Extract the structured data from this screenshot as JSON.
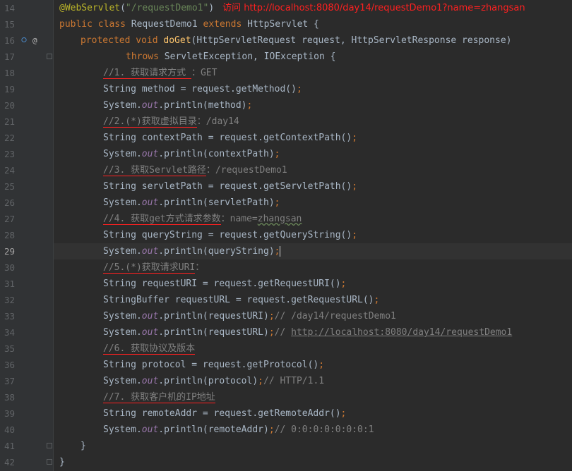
{
  "editor": {
    "current_line": 29,
    "annotation_note": "访问 http://localhost:8080/day14/requestDemo1?name=zhangsan",
    "lines": [
      {
        "n": 14,
        "indent": 0,
        "parts": [
          [
            "ann",
            "@WebServlet"
          ],
          [
            "",
            "("
          ],
          [
            "str",
            "\"/requestDemo1\""
          ],
          [
            "",
            ")"
          ]
        ],
        "note": true
      },
      {
        "n": 15,
        "indent": 0,
        "parts": [
          [
            "kw",
            "public class "
          ],
          [
            "",
            "RequestDemo1 "
          ],
          [
            "kw",
            "extends "
          ],
          [
            "",
            "HttpServlet {"
          ]
        ]
      },
      {
        "n": 16,
        "indent": 1,
        "parts": [
          [
            "kw",
            "protected void "
          ],
          [
            "fn",
            "doGet"
          ],
          [
            "",
            "(HttpServletRequest request, HttpServletResponse response)"
          ]
        ]
      },
      {
        "n": 17,
        "indent": 3,
        "parts": [
          [
            "kw",
            "throws "
          ],
          [
            "",
            "ServletException, IOException {"
          ]
        ]
      },
      {
        "n": 18,
        "indent": 2,
        "parts": [
          [
            "cm ul",
            "//1. 获取请求方式 "
          ],
          [
            "cm",
            "：GET"
          ]
        ]
      },
      {
        "n": 19,
        "indent": 2,
        "parts": [
          [
            "",
            "String method = request.getMethod()"
          ],
          [
            "kw",
            ";"
          ]
        ]
      },
      {
        "n": 20,
        "indent": 2,
        "parts": [
          [
            "",
            "System."
          ],
          [
            "fld",
            "out"
          ],
          [
            "",
            ".println(method)"
          ],
          [
            "kw",
            ";"
          ]
        ]
      },
      {
        "n": 21,
        "indent": 2,
        "parts": [
          [
            "cm ul",
            "//2.(*)获取虚拟目录"
          ],
          [
            "cm",
            "：/day14"
          ]
        ]
      },
      {
        "n": 22,
        "indent": 2,
        "parts": [
          [
            "",
            "String contextPath = request.getContextPath()"
          ],
          [
            "kw",
            ";"
          ]
        ]
      },
      {
        "n": 23,
        "indent": 2,
        "parts": [
          [
            "",
            "System."
          ],
          [
            "fld",
            "out"
          ],
          [
            "",
            ".println(contextPath)"
          ],
          [
            "kw",
            ";"
          ]
        ]
      },
      {
        "n": 24,
        "indent": 2,
        "parts": [
          [
            "cm ul",
            "//3. 获取Servlet路径"
          ],
          [
            "cm",
            "：/requestDemo1"
          ]
        ]
      },
      {
        "n": 25,
        "indent": 2,
        "parts": [
          [
            "",
            "String servletPath = request.getServletPath()"
          ],
          [
            "kw",
            ";"
          ]
        ]
      },
      {
        "n": 26,
        "indent": 2,
        "parts": [
          [
            "",
            "System."
          ],
          [
            "fld",
            "out"
          ],
          [
            "",
            ".println(servletPath)"
          ],
          [
            "kw",
            ";"
          ]
        ]
      },
      {
        "n": 27,
        "indent": 2,
        "parts": [
          [
            "cm ul",
            "//4. 获取get方式请求参数"
          ],
          [
            "cm",
            "：name="
          ],
          [
            "cm wavy",
            "zhangsan"
          ]
        ]
      },
      {
        "n": 28,
        "indent": 2,
        "parts": [
          [
            "",
            "String queryString = request.getQueryString()"
          ],
          [
            "kw",
            ";"
          ]
        ]
      },
      {
        "n": 29,
        "indent": 2,
        "parts": [
          [
            "",
            "System."
          ],
          [
            "fld",
            "out"
          ],
          [
            "",
            ".println(queryString)"
          ],
          [
            "kw",
            ";"
          ],
          [
            "caret",
            ""
          ]
        ]
      },
      {
        "n": 30,
        "indent": 2,
        "parts": [
          [
            "cm ul",
            "//5.(*)获取请求URI"
          ],
          [
            "cm",
            "："
          ]
        ]
      },
      {
        "n": 31,
        "indent": 2,
        "parts": [
          [
            "",
            "String requestURI = request.getRequestURI()"
          ],
          [
            "kw",
            ";"
          ]
        ]
      },
      {
        "n": 32,
        "indent": 2,
        "parts": [
          [
            "",
            "StringBuffer requestURL = request.getRequestURL()"
          ],
          [
            "kw",
            ";"
          ]
        ]
      },
      {
        "n": 33,
        "indent": 2,
        "parts": [
          [
            "",
            "System."
          ],
          [
            "fld",
            "out"
          ],
          [
            "",
            ".println(requestURI)"
          ],
          [
            "kw",
            ";"
          ],
          [
            "cm",
            "// /day14/requestDemo1"
          ]
        ]
      },
      {
        "n": 34,
        "indent": 2,
        "parts": [
          [
            "",
            "System."
          ],
          [
            "fld",
            "out"
          ],
          [
            "",
            ".println(requestURL)"
          ],
          [
            "kw",
            ";"
          ],
          [
            "cm",
            "// "
          ],
          [
            "cm link",
            "http://localhost:8080/day14/requestDemo1"
          ]
        ]
      },
      {
        "n": 35,
        "indent": 2,
        "parts": [
          [
            "cm ul",
            "//6. 获取协议及版本"
          ]
        ]
      },
      {
        "n": 36,
        "indent": 2,
        "parts": [
          [
            "",
            "String protocol = request.getProtocol()"
          ],
          [
            "kw",
            ";"
          ]
        ]
      },
      {
        "n": 37,
        "indent": 2,
        "parts": [
          [
            "",
            "System."
          ],
          [
            "fld",
            "out"
          ],
          [
            "",
            ".println(protocol)"
          ],
          [
            "kw",
            ";"
          ],
          [
            "cm",
            "// HTTP/1.1"
          ]
        ]
      },
      {
        "n": 38,
        "indent": 2,
        "parts": [
          [
            "cm ul",
            "//7. 获取客户机的IP地址"
          ]
        ]
      },
      {
        "n": 39,
        "indent": 2,
        "parts": [
          [
            "",
            "String remoteAddr = request.getRemoteAddr()"
          ],
          [
            "kw",
            ";"
          ]
        ]
      },
      {
        "n": 40,
        "indent": 2,
        "parts": [
          [
            "",
            "System."
          ],
          [
            "fld",
            "out"
          ],
          [
            "",
            ".println(remoteAddr)"
          ],
          [
            "kw",
            ";"
          ],
          [
            "cm",
            "// 0:0:0:0:0:0:0:1"
          ]
        ]
      },
      {
        "n": 41,
        "indent": 1,
        "parts": [
          [
            "",
            "}"
          ]
        ]
      },
      {
        "n": 42,
        "indent": 0,
        "parts": [
          [
            "",
            "}"
          ]
        ]
      }
    ],
    "gutter_icons": {
      "line": 16,
      "icons": [
        "override-icon",
        "annotation-icon"
      ]
    },
    "fold_lines": [
      17,
      41,
      42
    ]
  }
}
